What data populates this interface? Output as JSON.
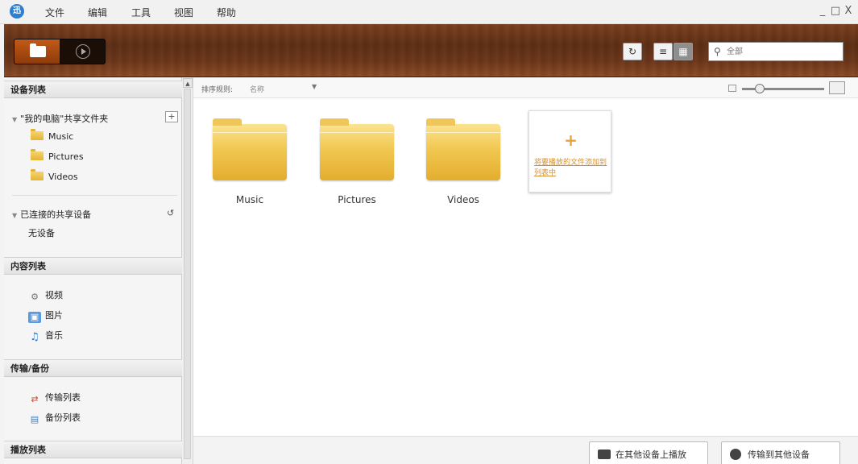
{
  "menu": {
    "logo": "迅",
    "items": [
      "文件",
      "编辑",
      "工具",
      "视图",
      "帮助"
    ],
    "controls": [
      "_",
      "□",
      "X"
    ]
  },
  "toolbar": {
    "refresh_symbol": "↻",
    "list_view_symbol": "≡",
    "grid_view_symbol": "▦",
    "search_placeholder": "全部"
  },
  "sidebar": {
    "device_list": {
      "title": "设备列表",
      "my_computer": "\"我的电脑\"共享文件夹",
      "add_symbol": "+",
      "folders": [
        "Music",
        "Pictures",
        "Videos"
      ],
      "connected": "已连接的共享设备",
      "refresh_symbol": "↺",
      "no_device": "无设备"
    },
    "content_list": {
      "title": "内容列表",
      "items": [
        {
          "label": "视频",
          "icon": "video-icon"
        },
        {
          "label": "图片",
          "icon": "picture-icon"
        },
        {
          "label": "音乐",
          "icon": "music-icon"
        }
      ]
    },
    "transfer": {
      "title": "传输/备份",
      "items": [
        {
          "label": "传输列表",
          "icon": "transfer-icon"
        },
        {
          "label": "备份列表",
          "icon": "backup-icon"
        }
      ]
    },
    "playlist": {
      "title": "播放列表"
    }
  },
  "main": {
    "sort_label": "排序规则:",
    "sort_value": "名称",
    "folders": [
      "Music",
      "Pictures",
      "Videos"
    ],
    "add_card": {
      "plus": "+",
      "text": "将要播放的文件添加到列表中"
    },
    "bottom_buttons": [
      "在其他设备上播放",
      "传输到其他设备"
    ]
  },
  "colors": {
    "accent_orange": "#c25a17",
    "folder_yellow": "#f1c750",
    "wood_brown": "#6b3519",
    "link_orange": "#d49030"
  }
}
